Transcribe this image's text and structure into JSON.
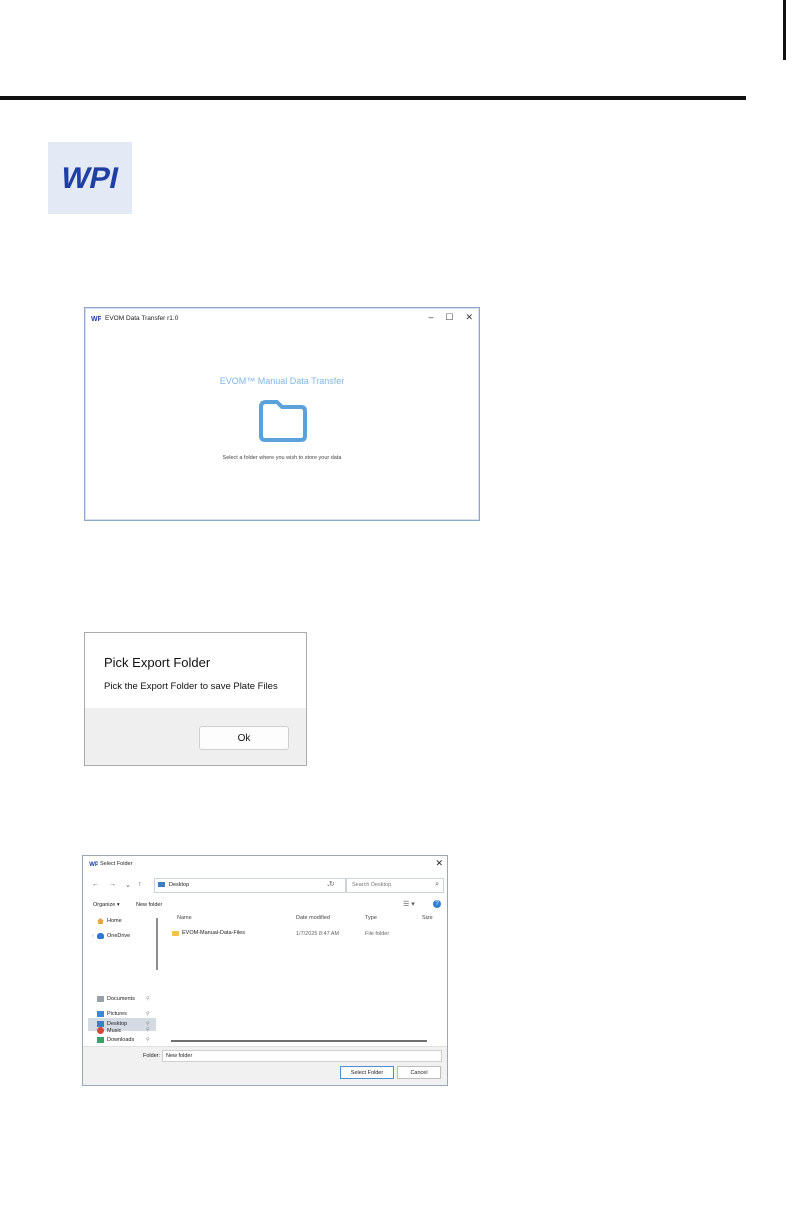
{
  "logo": {
    "text": "WPI",
    "color": "#1f3fa5"
  },
  "screen1": {
    "title": "EVOM Data Transfer r1.0",
    "controls": [
      "–",
      "☐",
      "✕"
    ],
    "heading": "EVOM™ Manual Data Transfer",
    "instruction": "Select a folder where you wish to store your data",
    "icon": "folder-icon",
    "accent": "#5aa2dc"
  },
  "screen2": {
    "heading": "Pick Export Folder",
    "message": "Pick the Export Folder to save Plate Files",
    "ok_label": "Ok"
  },
  "screen3": {
    "title": "Select Folder",
    "address": "Desktop",
    "search_placeholder": "Search Desktop",
    "organize_label": "Organize ▾",
    "new_folder_label": "New folder",
    "nav_items": [
      {
        "label": "Home",
        "icon": "home-icon"
      },
      {
        "label": "OneDrive",
        "icon": "cloud-icon"
      },
      {
        "label": "Desktop",
        "icon": "desktop-icon"
      },
      {
        "label": "Downloads",
        "icon": "download-icon"
      },
      {
        "label": "Documents",
        "icon": "documents-icon"
      },
      {
        "label": "Pictures",
        "icon": "pictures-icon"
      },
      {
        "label": "Music",
        "icon": "music-icon"
      }
    ],
    "columns": [
      "Name",
      "Date modified",
      "Type",
      "Size"
    ],
    "rows": [
      {
        "name": "EVOM-Manual-Data-Files",
        "date": "1/7/2025 8:47 AM",
        "type": "File folder",
        "size": ""
      }
    ],
    "folder_label": "Folder:",
    "folder_value": "New folder",
    "select_label": "Select Folder",
    "cancel_label": "Cancel"
  }
}
